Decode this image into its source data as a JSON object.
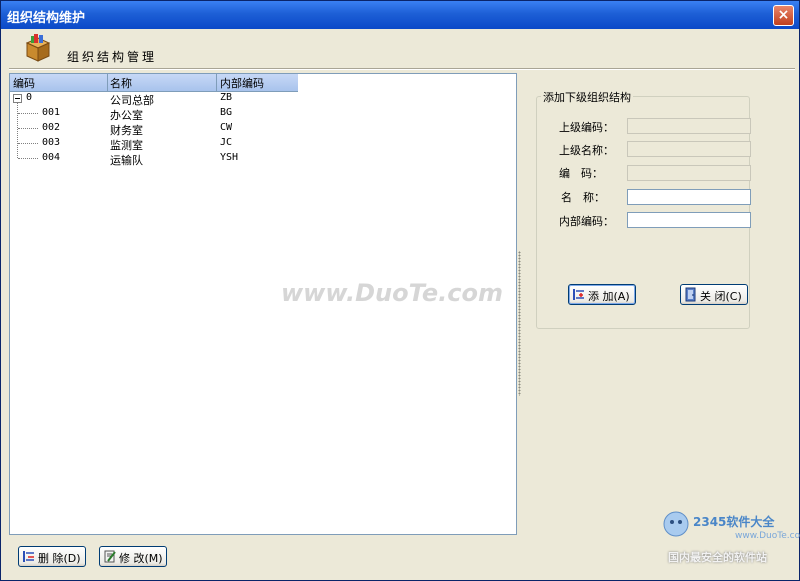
{
  "window": {
    "title": "组织结构维护",
    "close_label": "×"
  },
  "header": {
    "title": "组织结构管理"
  },
  "tree": {
    "columns": [
      "编码",
      "名称",
      "内部编码"
    ],
    "root": {
      "code": "0",
      "name": "公司总部",
      "internal": "ZB"
    },
    "children": [
      {
        "code": "001",
        "name": "办公室",
        "internal": "BG"
      },
      {
        "code": "002",
        "name": "财务室",
        "internal": "CW"
      },
      {
        "code": "003",
        "name": "监测室",
        "internal": "JC"
      },
      {
        "code": "004",
        "name": "运输队",
        "internal": "YSH"
      }
    ]
  },
  "form": {
    "group_title": "添加下级组织结构",
    "labels": {
      "parent_code": "上级编码：",
      "parent_name": "上级名称：",
      "code": "编　码：",
      "name": "名　称：",
      "internal_code": "内部编码："
    },
    "values": {
      "parent_code": "",
      "parent_name": "",
      "code": "",
      "name": "",
      "internal_code": ""
    }
  },
  "buttons": {
    "add": "添 加(A)",
    "close": "关 闭(C)",
    "delete": "删 除(D)",
    "modify": "修 改(M)"
  },
  "watermark": {
    "text": "www.DuoTe.com",
    "brand": "2345软件大全",
    "url": "www.DuoTe.com",
    "slogan": "国内最安全的软件站"
  }
}
